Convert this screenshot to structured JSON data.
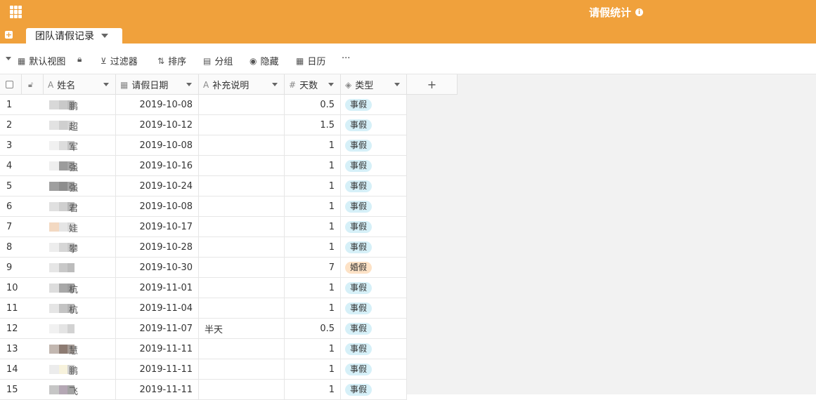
{
  "app": {
    "title": "请假统计",
    "info_icon": "info-icon",
    "accent": "#f0a13c"
  },
  "table_tab": {
    "label": "团队请假记录"
  },
  "toolbar": {
    "view_label": "默认视图",
    "filter_label": "过滤器",
    "sort_label": "排序",
    "group_label": "分组",
    "hide_label": "隐藏",
    "calendar_label": "日历",
    "more_label": "···"
  },
  "columns": [
    {
      "key": "name",
      "label": "姓名",
      "icon": "text-field-icon"
    },
    {
      "key": "date",
      "label": "请假日期",
      "icon": "date-field-icon"
    },
    {
      "key": "note",
      "label": "补充说明",
      "icon": "text-field-icon"
    },
    {
      "key": "days",
      "label": "天数",
      "icon": "number-field-icon"
    },
    {
      "key": "type",
      "label": "类型",
      "icon": "select-field-icon"
    }
  ],
  "add_column_label": "+",
  "rows": [
    {
      "idx": "1",
      "name_tail": "鹏",
      "date": "2019-10-08",
      "note": "",
      "days": "0.5",
      "type": "事假"
    },
    {
      "idx": "2",
      "name_tail": "超",
      "date": "2019-10-12",
      "note": "",
      "days": "1.5",
      "type": "事假"
    },
    {
      "idx": "3",
      "name_tail": "军",
      "date": "2019-10-08",
      "note": "",
      "days": "1",
      "type": "事假"
    },
    {
      "idx": "4",
      "name_tail": "强",
      "date": "2019-10-16",
      "note": "",
      "days": "1",
      "type": "事假"
    },
    {
      "idx": "5",
      "name_tail": "强",
      "date": "2019-10-24",
      "note": "",
      "days": "1",
      "type": "事假"
    },
    {
      "idx": "6",
      "name_tail": "君",
      "date": "2019-10-08",
      "note": "",
      "days": "1",
      "type": "事假"
    },
    {
      "idx": "7",
      "name_tail": "娃",
      "date": "2019-10-17",
      "note": "",
      "days": "1",
      "type": "事假"
    },
    {
      "idx": "8",
      "name_tail": "攀",
      "date": "2019-10-28",
      "note": "",
      "days": "1",
      "type": "事假"
    },
    {
      "idx": "9",
      "name_tail": "",
      "date": "2019-10-30",
      "note": "",
      "days": "7",
      "type": "婚假"
    },
    {
      "idx": "10",
      "name_tail": "杭",
      "date": "2019-11-01",
      "note": "",
      "days": "1",
      "type": "事假"
    },
    {
      "idx": "11",
      "name_tail": "杭",
      "date": "2019-11-04",
      "note": "",
      "days": "1",
      "type": "事假"
    },
    {
      "idx": "12",
      "name_tail": "",
      "date": "2019-11-07",
      "note": "半天",
      "days": "0.5",
      "type": "事假"
    },
    {
      "idx": "13",
      "name_tail": "慧",
      "date": "2019-11-11",
      "note": "",
      "days": "1",
      "type": "事假"
    },
    {
      "idx": "14",
      "name_tail": "鹏",
      "date": "2019-11-11",
      "note": "",
      "days": "1",
      "type": "事假"
    },
    {
      "idx": "15",
      "name_tail": "飞",
      "date": "2019-11-11",
      "note": "",
      "days": "1",
      "type": "事假"
    }
  ]
}
